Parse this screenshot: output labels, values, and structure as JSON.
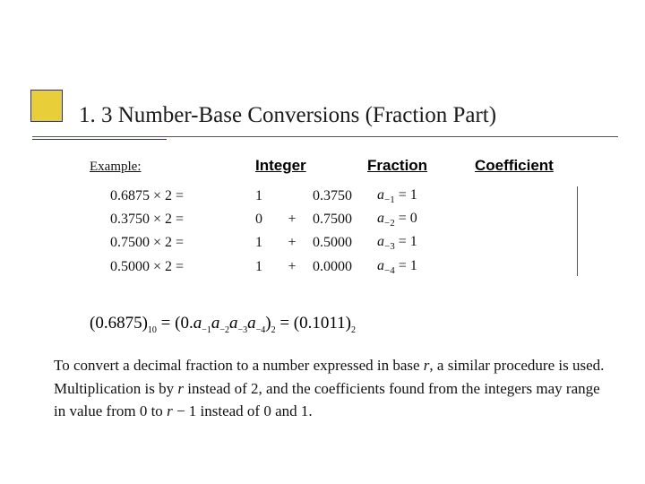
{
  "title": "1. 3 Number-Base Conversions (Fraction Part)",
  "exampleLabel": "Example:",
  "headers": {
    "integer": "Integer",
    "fraction": "Fraction",
    "coefficient": "Coefficient"
  },
  "rows": [
    {
      "mult": "0.6875  ×  2  =",
      "int": "1",
      "plus": "",
      "frac": "0.3750",
      "coefA": "a",
      "coefSub": "−1",
      "coefEq": " =  1"
    },
    {
      "mult": "0.3750  ×  2  =",
      "int": "0",
      "plus": "+",
      "frac": "0.7500",
      "coefA": "a",
      "coefSub": "−2",
      "coefEq": " =  0"
    },
    {
      "mult": "0.7500  ×  2  =",
      "int": "1",
      "plus": "+",
      "frac": "0.5000",
      "coefA": "a",
      "coefSub": "−3",
      "coefEq": " =  1"
    },
    {
      "mult": "0.5000  ×  2  =",
      "int": "1",
      "plus": "+",
      "frac": "0.0000",
      "coefA": "a",
      "coefSub": "−4",
      "coefEq": " =  1"
    }
  ],
  "equation": {
    "lhs_open": "(0.6875)",
    "lhs_sub": "10",
    "mid_open": " = (0.",
    "a1": "a",
    "s1": "−1",
    "a2": "a",
    "s2": "−2",
    "a3": "a",
    "s3": "−3",
    "a4": "a",
    "s4": "−4",
    "mid_close": ")",
    "mid_sub": "2",
    "rhs": " = (0.1011)",
    "rhs_sub": "2"
  },
  "para": {
    "p1": "To convert a decimal fraction to a number expressed in base ",
    "r1": "r",
    "p2": ", a similar procedure is used. Multiplication is by ",
    "r2": "r",
    "p3": " instead of 2, and the coefficients found from the integers may range in value from 0 to ",
    "r3": "r",
    "p4": " − 1 instead of 0 and 1."
  }
}
